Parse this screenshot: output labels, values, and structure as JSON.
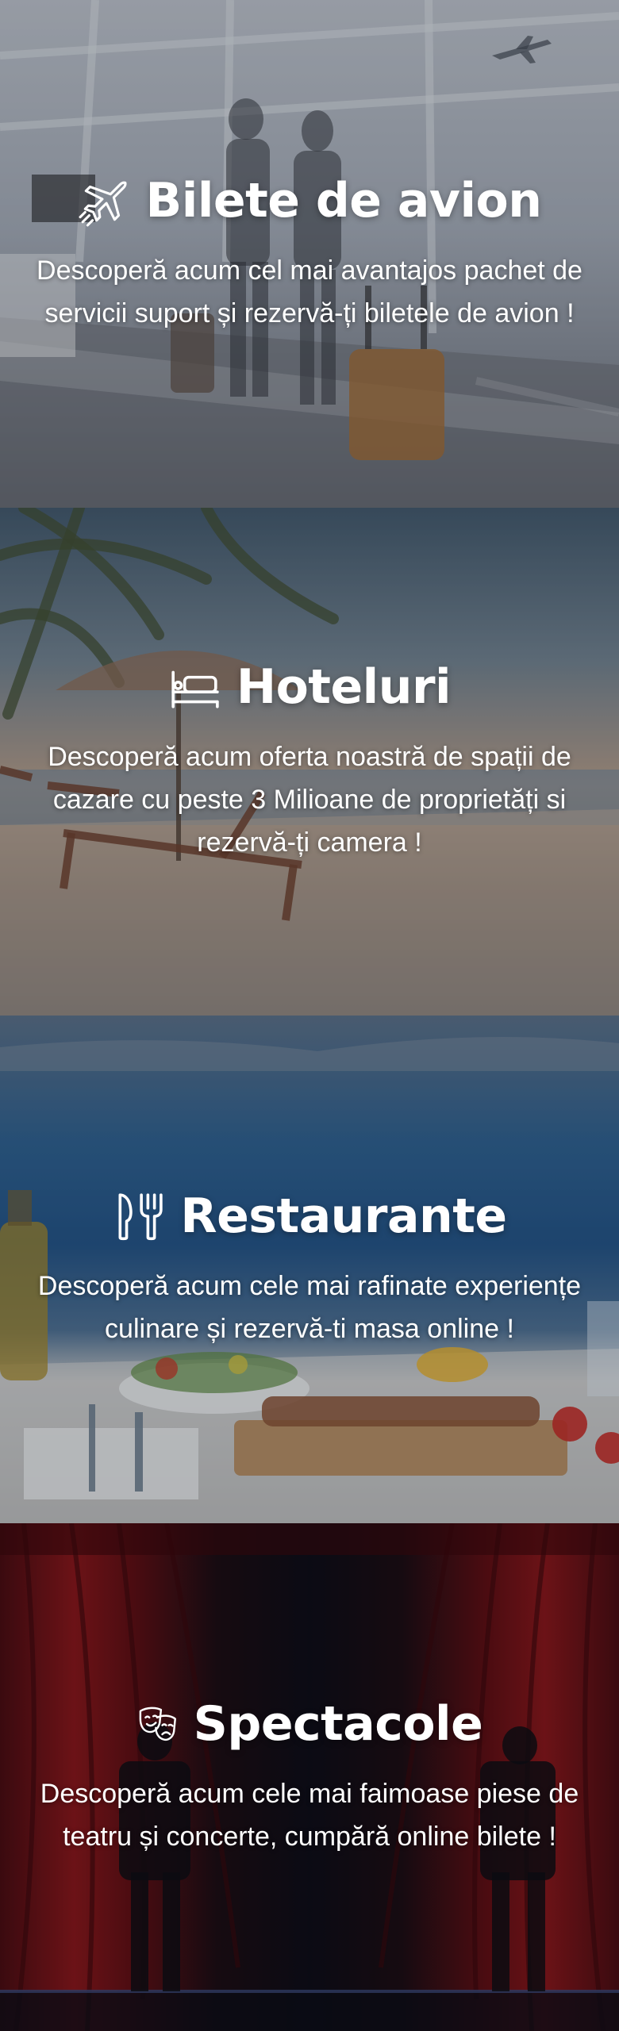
{
  "sections": [
    {
      "icon": "airplane-icon",
      "title": "Bilete de avion",
      "description": "Descoperă acum cel mai avantajos pachet de servicii suport și rezervă-ți biletele de avion !"
    },
    {
      "icon": "bed-icon",
      "title": "Hoteluri",
      "description": "Descoperă acum oferta noastră de spații de cazare cu peste 3 Milioane de proprietăți si rezervă-ți camera !"
    },
    {
      "icon": "fork-knife-icon",
      "title": "Restaurante",
      "description": "Descoperă acum cele mai rafinate experiențe culinare și rezervă-ti masa online !"
    },
    {
      "icon": "theater-masks-icon",
      "title": "Spectacole",
      "description": "Descoperă acum cele mai faimoase piese de teatru și concerte, cumpără online bilete !"
    }
  ]
}
